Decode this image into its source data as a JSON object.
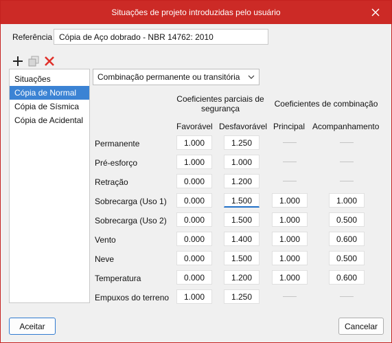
{
  "window": {
    "title": "Situações de projeto introduzidas pelo usuário",
    "close_glyph": "✕"
  },
  "reference": {
    "label": "Referência",
    "value": "Cópia de Aço dobrado - NBR 14762: 2010"
  },
  "toolbar": {
    "icons": [
      "add-icon",
      "copy-icon",
      "delete-icon"
    ]
  },
  "situations": {
    "header": "Situações",
    "items": [
      "Cópia de Normal",
      "Cópia de Sísmica",
      "Cópia de Acidental"
    ],
    "selected": "Cópia de Normal"
  },
  "combination_type": {
    "selected": "Combinação permanente ou transitória",
    "chevron": "⌄"
  },
  "table": {
    "group_partial": "Coeficientes parciais de segurança",
    "group_combination": "Coeficientes de combinação",
    "col_favoravel": "Favorável",
    "col_desfavoravel": "Desfavorável",
    "col_principal": "Principal",
    "col_acompanhamento": "Acompanhamento",
    "rows": [
      {
        "label": "Permanente",
        "fav": "1.000",
        "desf": "1.250",
        "principal": null,
        "acomp": null
      },
      {
        "label": "Pré-esforço",
        "fav": "1.000",
        "desf": "1.000",
        "principal": null,
        "acomp": null
      },
      {
        "label": "Retração",
        "fav": "0.000",
        "desf": "1.200",
        "principal": null,
        "acomp": null
      },
      {
        "label": "Sobrecarga (Uso 1)",
        "fav": "0.000",
        "desf": "1.500",
        "principal": "1.000",
        "acomp": "1.000"
      },
      {
        "label": "Sobrecarga (Uso 2)",
        "fav": "0.000",
        "desf": "1.500",
        "principal": "1.000",
        "acomp": "0.500"
      },
      {
        "label": "Vento",
        "fav": "0.000",
        "desf": "1.400",
        "principal": "1.000",
        "acomp": "0.600"
      },
      {
        "label": "Neve",
        "fav": "0.000",
        "desf": "1.500",
        "principal": "1.000",
        "acomp": "0.500"
      },
      {
        "label": "Temperatura",
        "fav": "0.000",
        "desf": "1.200",
        "principal": "1.000",
        "acomp": "0.600"
      },
      {
        "label": "Empuxos do terreno",
        "fav": "1.000",
        "desf": "1.250",
        "principal": null,
        "acomp": null
      }
    ]
  },
  "buttons": {
    "accept": "Aceitar",
    "cancel": "Cancelar"
  },
  "colors": {
    "titlebar": "#cc2a26",
    "selection": "#3b83d4",
    "delete": "#e0302a"
  }
}
